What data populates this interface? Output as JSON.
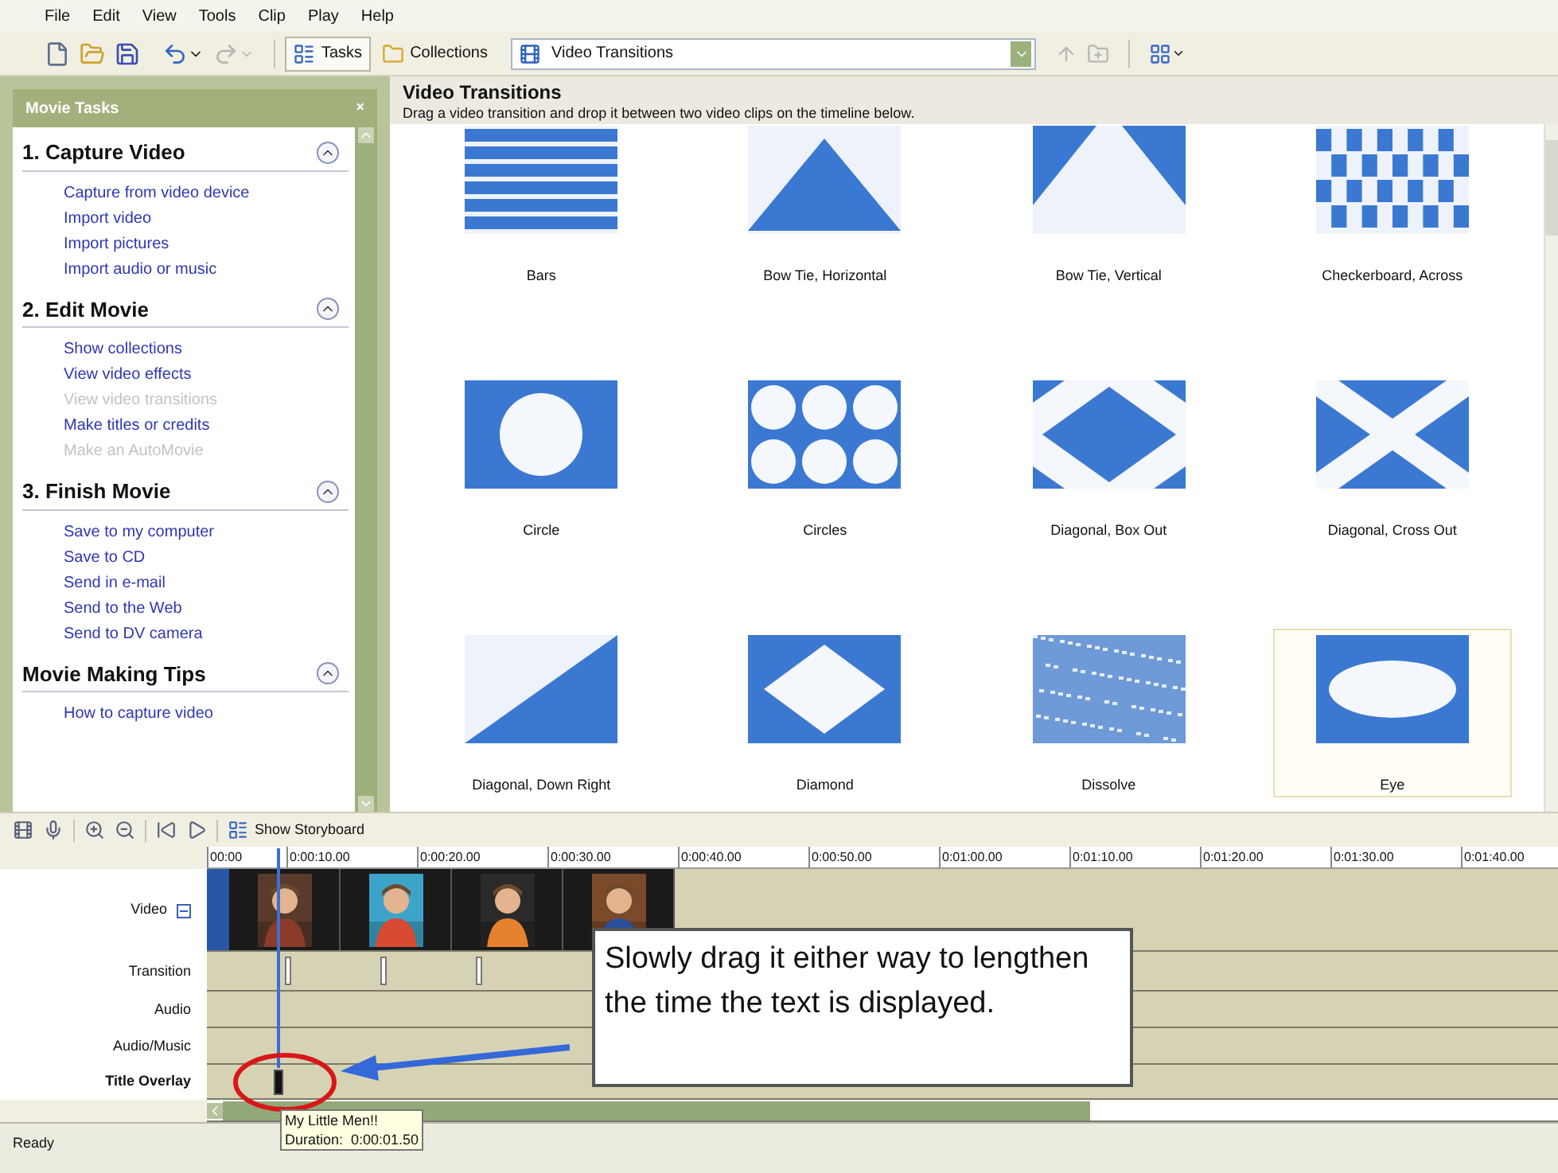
{
  "menu": [
    "File",
    "Edit",
    "View",
    "Tools",
    "Clip",
    "Play",
    "Help"
  ],
  "toolbar": {
    "buttons": [
      {
        "kind": "new",
        "disabled": false
      },
      {
        "kind": "open",
        "disabled": false
      },
      {
        "kind": "save",
        "disabled": false
      },
      {
        "kind": "undo",
        "disabled": false
      },
      {
        "kind": "redo",
        "disabled": true
      }
    ],
    "toggles": [
      {
        "kind": "tasks",
        "label": "Tasks",
        "selected": true
      },
      {
        "kind": "collections",
        "label": "Collections",
        "selected": false
      }
    ],
    "location": "Video Transitions"
  },
  "task_pane": {
    "title": "Movie Tasks",
    "close": "×",
    "sections": [
      {
        "title": "1. Capture Video",
        "expanded": true,
        "links": [
          {
            "label": "Capture from video device",
            "disabled": false
          },
          {
            "label": "Import video",
            "disabled": false
          },
          {
            "label": "Import pictures",
            "disabled": false
          },
          {
            "label": "Import audio or music",
            "disabled": false
          }
        ]
      },
      {
        "title": "2. Edit Movie",
        "expanded": true,
        "links": [
          {
            "label": "Show collections",
            "disabled": false
          },
          {
            "label": "View video effects",
            "disabled": false
          },
          {
            "label": "View video transitions",
            "disabled": true
          },
          {
            "label": "Make titles or credits",
            "disabled": false
          },
          {
            "label": "Make an AutoMovie",
            "disabled": true
          }
        ]
      },
      {
        "title": "3. Finish Movie",
        "expanded": true,
        "links": [
          {
            "label": "Save to my computer",
            "disabled": false
          },
          {
            "label": "Save to CD",
            "disabled": false
          },
          {
            "label": "Send in e-mail",
            "disabled": false
          },
          {
            "label": "Send to the Web",
            "disabled": false
          },
          {
            "label": "Send to DV camera",
            "disabled": false
          }
        ]
      },
      {
        "title": "Movie Making Tips",
        "expanded": true,
        "links": [
          {
            "label": "How to capture video",
            "disabled": false
          }
        ]
      }
    ]
  },
  "content": {
    "title": "Video Transitions",
    "description": "Drag a video transition and drop it between two video clips on the timeline below.",
    "transitions": [
      {
        "kind": "bars",
        "label": "Bars",
        "selected": false
      },
      {
        "kind": "bowtie_h",
        "label": "Bow Tie, Horizontal",
        "selected": false
      },
      {
        "kind": "bowtie_v",
        "label": "Bow Tie, Vertical",
        "selected": false
      },
      {
        "kind": "checker",
        "label": "Checkerboard, Across",
        "selected": false
      },
      {
        "kind": "circle",
        "label": "Circle",
        "selected": false
      },
      {
        "kind": "circles",
        "label": "Circles",
        "selected": false
      },
      {
        "kind": "diag_box",
        "label": "Diagonal, Box Out",
        "selected": false
      },
      {
        "kind": "diag_cross",
        "label": "Diagonal, Cross Out",
        "selected": false
      },
      {
        "kind": "diag_down",
        "label": "Diagonal, Down Right",
        "selected": false
      },
      {
        "kind": "diamond",
        "label": "Diamond",
        "selected": false
      },
      {
        "kind": "dissolve",
        "label": "Dissolve",
        "selected": false
      },
      {
        "kind": "eye",
        "label": "Eye",
        "selected": true
      }
    ]
  },
  "timeline": {
    "show_storyboard": "Show Storyboard",
    "ruler": [
      "00:00",
      "0:00:10.00",
      "0:00:20.00",
      "0:00:30.00",
      "0:00:40.00",
      "0:00:50.00",
      "0:01:00.00",
      "0:01:10.00",
      "0:01:20.00",
      "0:01:30.00",
      "0:01:40.00"
    ],
    "tracks": [
      {
        "kind": "video",
        "label": "Video",
        "expanded": true
      },
      {
        "kind": "transition",
        "label": "Transition"
      },
      {
        "kind": "audio",
        "label": "Audio"
      },
      {
        "kind": "music",
        "label": "Audio/Music"
      },
      {
        "kind": "title",
        "label": "Title Overlay"
      }
    ],
    "video_clips": [
      {
        "kind": "picture"
      },
      {
        "kind": "picture"
      },
      {
        "kind": "picture"
      },
      {
        "kind": "picture"
      }
    ],
    "tooltip": {
      "title": "My Little Men!!",
      "duration": "Duration:  0:00:01.50"
    }
  },
  "callout": "Slowly drag it either way to lengthen the time the text is displayed.",
  "status_bar": "Ready"
}
